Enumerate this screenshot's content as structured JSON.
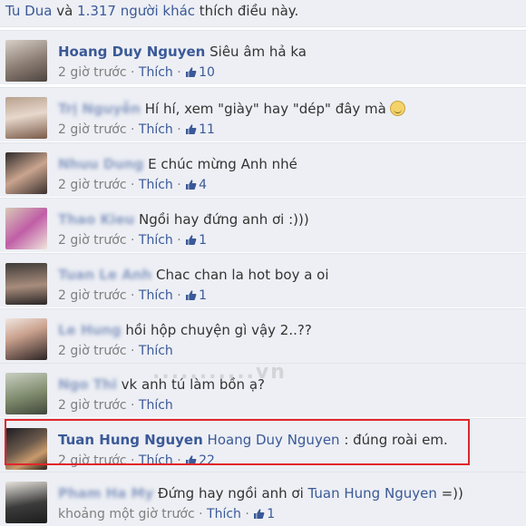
{
  "summary": {
    "first_liker": "Tu Dua",
    "conjunction": " và ",
    "others": "1.317 người khác",
    "suffix": " thích điều này."
  },
  "like_label": "Thích",
  "separator": " · ",
  "comments": [
    {
      "author": "Hoang Duy Nguyen",
      "author_blurred": false,
      "mention": "",
      "text": "Siêu âm hả ka",
      "time": "2 giờ trước",
      "likes": "10"
    },
    {
      "author": "Trị Nguyễn",
      "author_blurred": true,
      "mention": "",
      "text": "Hí hí, xem \"giày\" hay \"dép\" đây mà",
      "time": "2 giờ trước",
      "likes": "11",
      "emoji": "smile-emoji"
    },
    {
      "author": "Nhuu Dung",
      "author_blurred": true,
      "mention": "",
      "text": "E chúc mừng Anh nhé",
      "time": "2 giờ trước",
      "likes": "4"
    },
    {
      "author": "Thao Kieu",
      "author_blurred": true,
      "mention": "",
      "text": "Ngồi hay đứng anh ơi :)))",
      "time": "2 giờ trước",
      "likes": "1"
    },
    {
      "author": "Tuan Le Anh",
      "author_blurred": true,
      "mention": "",
      "text": "Chac chan la hot boy a oi",
      "time": "2 giờ trước",
      "likes": "1"
    },
    {
      "author": "Le Hung",
      "author_blurred": true,
      "mention": "",
      "text": "hồi hộp chuyện gì vậy 2..??",
      "time": "2 giờ trước",
      "likes": ""
    },
    {
      "author": "Ngo Thi",
      "author_blurred": true,
      "mention": "",
      "text": "vk anh tú làm bồn ạ?",
      "time": "2 giờ trước",
      "likes": ""
    },
    {
      "author": "Tuan Hung Nguyen",
      "author_blurred": false,
      "mention": "Hoang Duy Nguyen",
      "text": " : đúng roài em.",
      "time": "2 giờ trước",
      "likes": "22"
    },
    {
      "author": "Pham Ha My",
      "author_blurred": true,
      "mention": "",
      "text": "Đứng hay ngồi anh ơi ",
      "mention_after": "Tuan Hung Nguyen",
      "text_after": " =))",
      "time": "khoảng một giờ trước",
      "likes": "1"
    }
  ],
  "colors": {
    "link": "#3b5998",
    "meta": "#7f7f7f",
    "background": "#edeff4",
    "highlight": "#e0262b"
  },
  "watermark_text": "...........vn"
}
